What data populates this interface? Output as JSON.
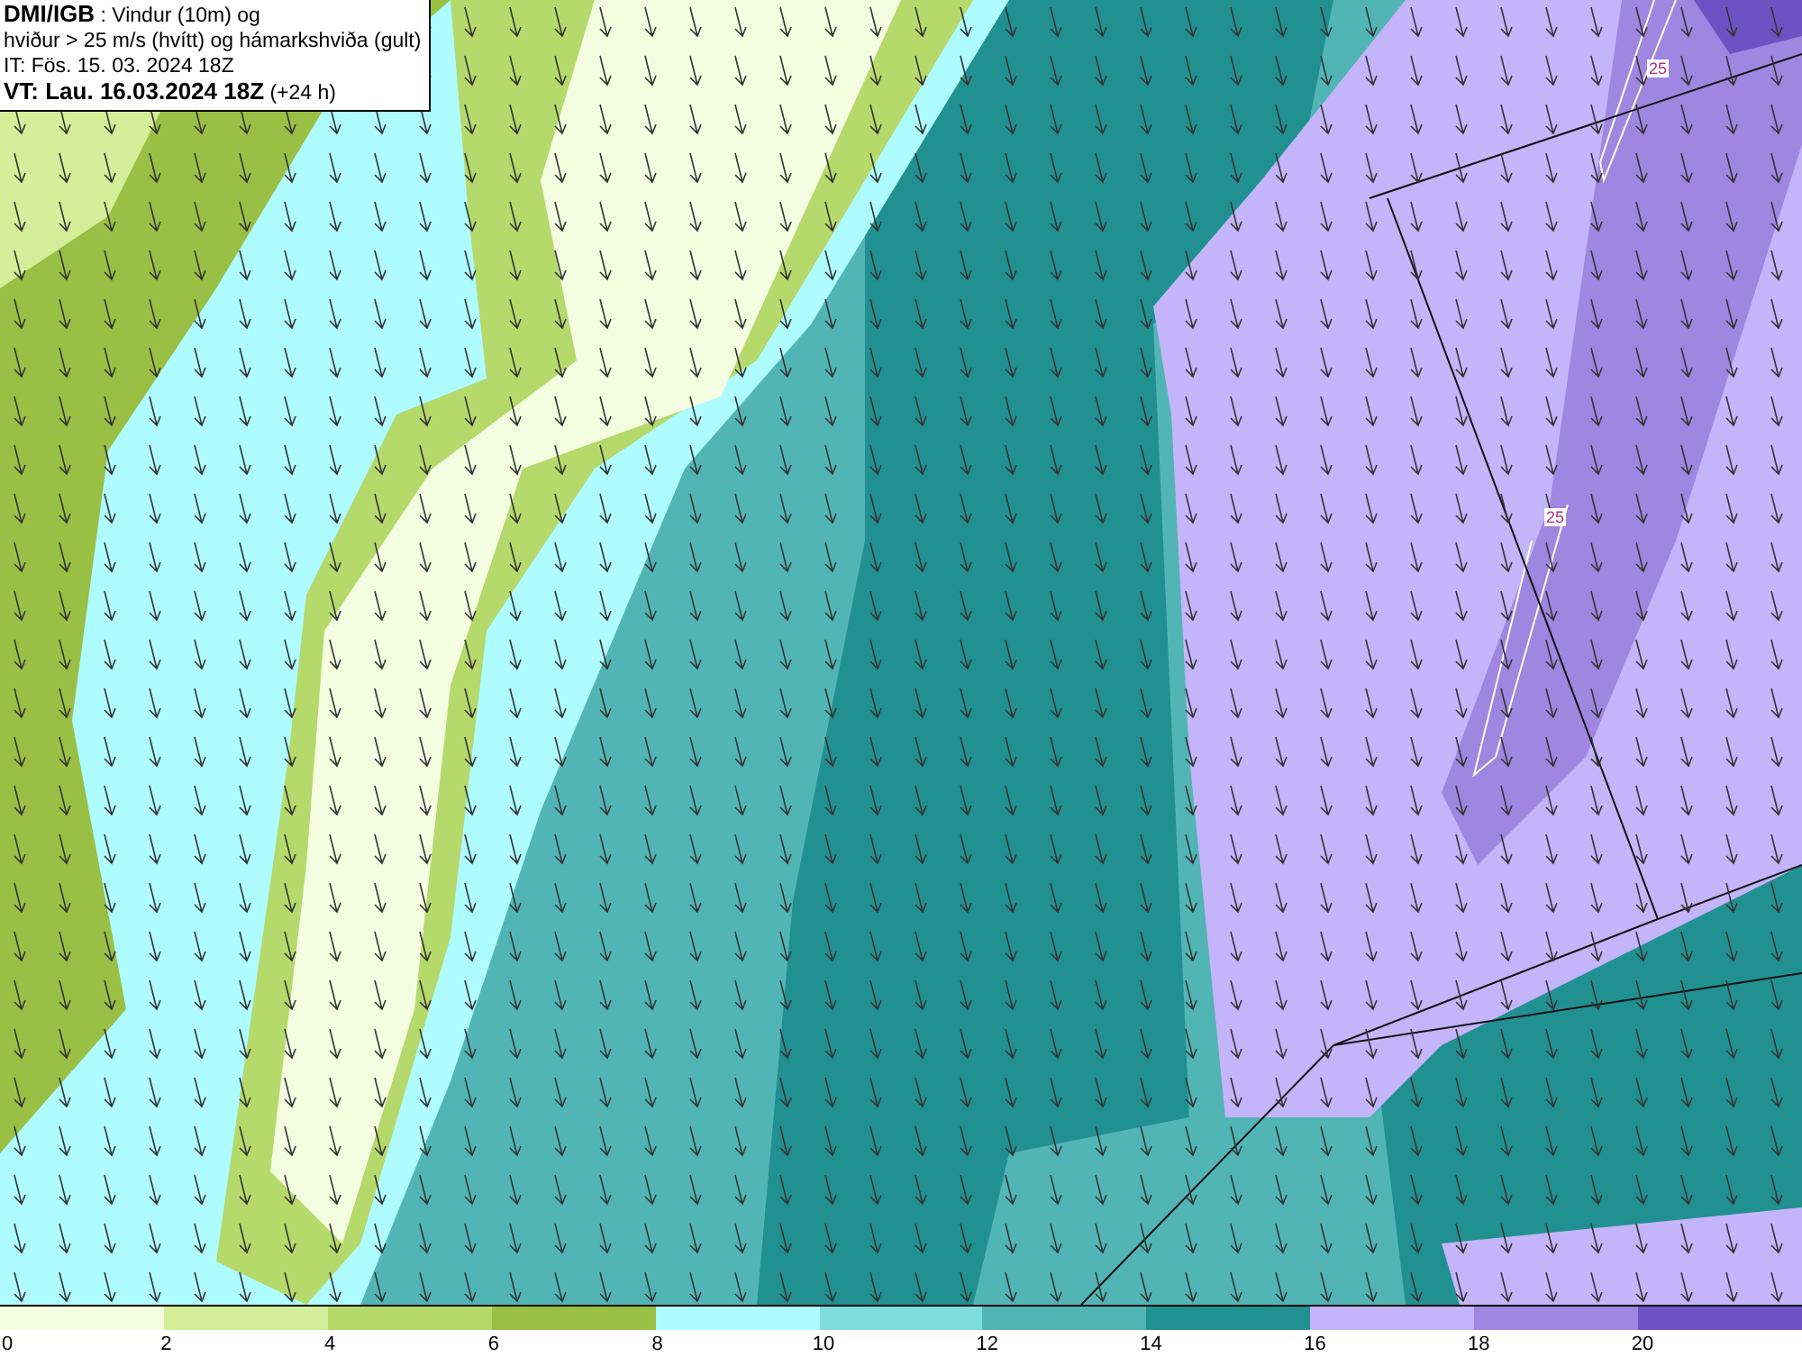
{
  "title_box": {
    "lines": [
      "**DMI/IGB** : Vindur (10m) og",
      "hviður > 25 m/s (hvítt) og hámarkshviða (gult)",
      "IT: Fös. 15. 03. 2024 18Z",
      "**VT: Lau. 16.03.2024 18Z** (+24 h)"
    ]
  },
  "map": {
    "contour_labels": [
      "25",
      "25"
    ]
  },
  "legend": [
    {
      "label": "0",
      "color": "#f4fde0"
    },
    {
      "label": "2",
      "color": "#d4ee9a"
    },
    {
      "label": "4",
      "color": "#b6d96c"
    },
    {
      "label": "6",
      "color": "#9abf45"
    },
    {
      "label": "8",
      "color": "#aefcff"
    },
    {
      "label": "10",
      "color": "#7fdcdc"
    },
    {
      "label": "12",
      "color": "#52b5b5"
    },
    {
      "label": "14",
      "color": "#219090"
    },
    {
      "label": "16",
      "color": "#c4b4fa"
    },
    {
      "label": "18",
      "color": "#9f86e0"
    },
    {
      "label": "20",
      "color": "#6e52c4"
    }
  ]
}
